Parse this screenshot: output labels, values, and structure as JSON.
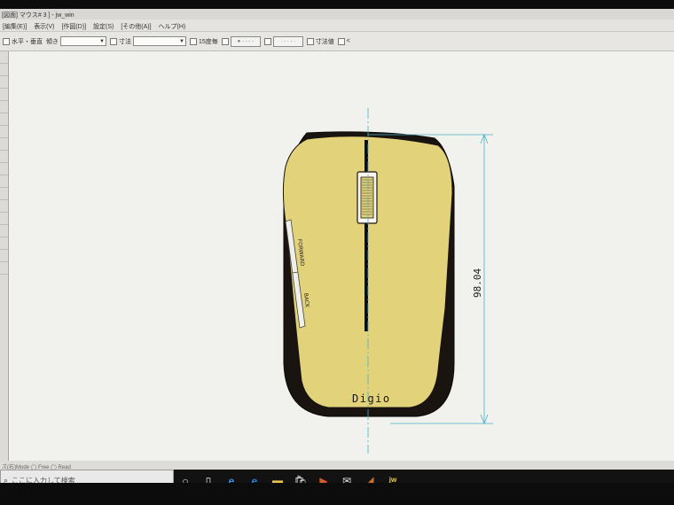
{
  "window": {
    "title": "[図面] マウス# 3 ] ‐ jw_win"
  },
  "menu": {
    "items": [
      "[編集(E)]",
      "表示(V)",
      "[作図(D)]",
      "設定(S)",
      "[その他(A)]",
      "ヘルプ(H)"
    ]
  },
  "toolbar": {
    "horizontal_vertical_label": "水平・垂直",
    "slope_label": "傾き",
    "slope_value": "",
    "dimension_label": "寸法",
    "dimension_value": "",
    "scale_label": "15度毎",
    "dimension_value_label": "寸法値",
    "bracket_label": "<"
  },
  "drawing": {
    "forward_label": "FORWARD",
    "back_label": "BACK",
    "brand_label": "Digio",
    "dimension_text": "98.04",
    "colors": {
      "body_dark": "#1a1410",
      "top_yellow": "#e2d27a",
      "dimension_line": "#4ab0c8"
    }
  },
  "status": {
    "text": "ズ(右)Mode  ◯ Free  ◯ Read"
  },
  "taskbar": {
    "search_placeholder": "ここに入力して検索",
    "icons": [
      "cortana-icon",
      "task-view-icon",
      "edge-icon",
      "ie-icon",
      "file-explorer-icon",
      "store-icon",
      "media-icon",
      "mail-icon",
      "app-icon",
      "jww-icon"
    ]
  }
}
